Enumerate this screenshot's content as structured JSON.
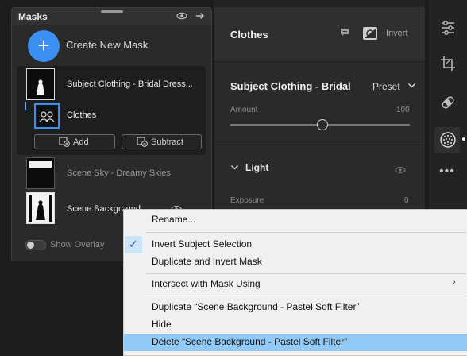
{
  "masks_panel": {
    "title": "Masks",
    "create_label": "Create New Mask",
    "create_icon": "+",
    "masks": [
      {
        "label": "Subject Clothing - Bridal Dress..."
      },
      {
        "label": "Clothes"
      },
      {
        "label": "Scene Sky - Dreamy Skies"
      },
      {
        "label": "Scene Background"
      }
    ],
    "add_label": "Add",
    "subtract_label": "Subtract",
    "show_overlay_label": "Show Overlay",
    "show_overlay_on": false
  },
  "properties": {
    "title": "Clothes",
    "invert_label": "Invert",
    "section_title": "Subject Clothing - Bridal",
    "preset_label": "Preset",
    "amount_label": "Amount",
    "amount_value": "100",
    "light_label": "Light",
    "exposure_label": "Exposure",
    "exposure_value": "0"
  },
  "toolbar": {
    "tools": [
      "sliders-icon",
      "crop-icon",
      "healing-icon",
      "masking-icon",
      "more-icon"
    ],
    "more_glyph": "•••",
    "active_tool": "masking-icon"
  },
  "context_menu": {
    "items": [
      {
        "label": "Rename..."
      },
      {
        "label": "Invert Subject Selection",
        "checked": true
      },
      {
        "label": "Duplicate and Invert Mask"
      },
      {
        "label": "Intersect with Mask Using",
        "submenu": true
      },
      {
        "label": "Duplicate “Scene Background - Pastel Soft Filter”"
      },
      {
        "label": "Hide"
      },
      {
        "label": "Delete “Scene Background - Pastel Soft Filter”",
        "highlighted": true
      }
    ],
    "check_glyph": "✓",
    "submenu_glyph": "›",
    "highlight_color": "#91c9f7"
  },
  "colors": {
    "accent": "#3b8ff0",
    "panel": "#2a2a2a",
    "menu_bg": "#f0f0f0"
  }
}
